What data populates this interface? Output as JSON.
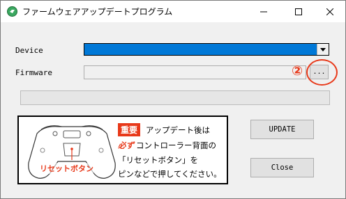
{
  "window": {
    "title": "ファームウェアアップデートプログラム",
    "controls": {
      "minimize_icon": "minimize-icon",
      "maximize_icon": "maximize-icon",
      "close_icon": "close-icon"
    }
  },
  "form": {
    "device_label": "Device",
    "device_value": "",
    "firmware_label": "Firmware",
    "firmware_value": "",
    "browse_label": "...",
    "progress": 0
  },
  "annotation": {
    "number": "②",
    "color": "#e8391a"
  },
  "notice": {
    "badge": "重要",
    "line1": "アップデート後は",
    "line2_red": "必ず",
    "line2": "コントローラー背面の",
    "line3": "「リセットボタン」を",
    "line4": "ピンなどで押してください。",
    "reset_label": "リセットボタン"
  },
  "buttons": {
    "update": "UPDATE",
    "close": "Close"
  },
  "colors": {
    "accent_blue": "#0078d7",
    "warning_red": "#e8391a",
    "background": "#f0f0f0"
  }
}
